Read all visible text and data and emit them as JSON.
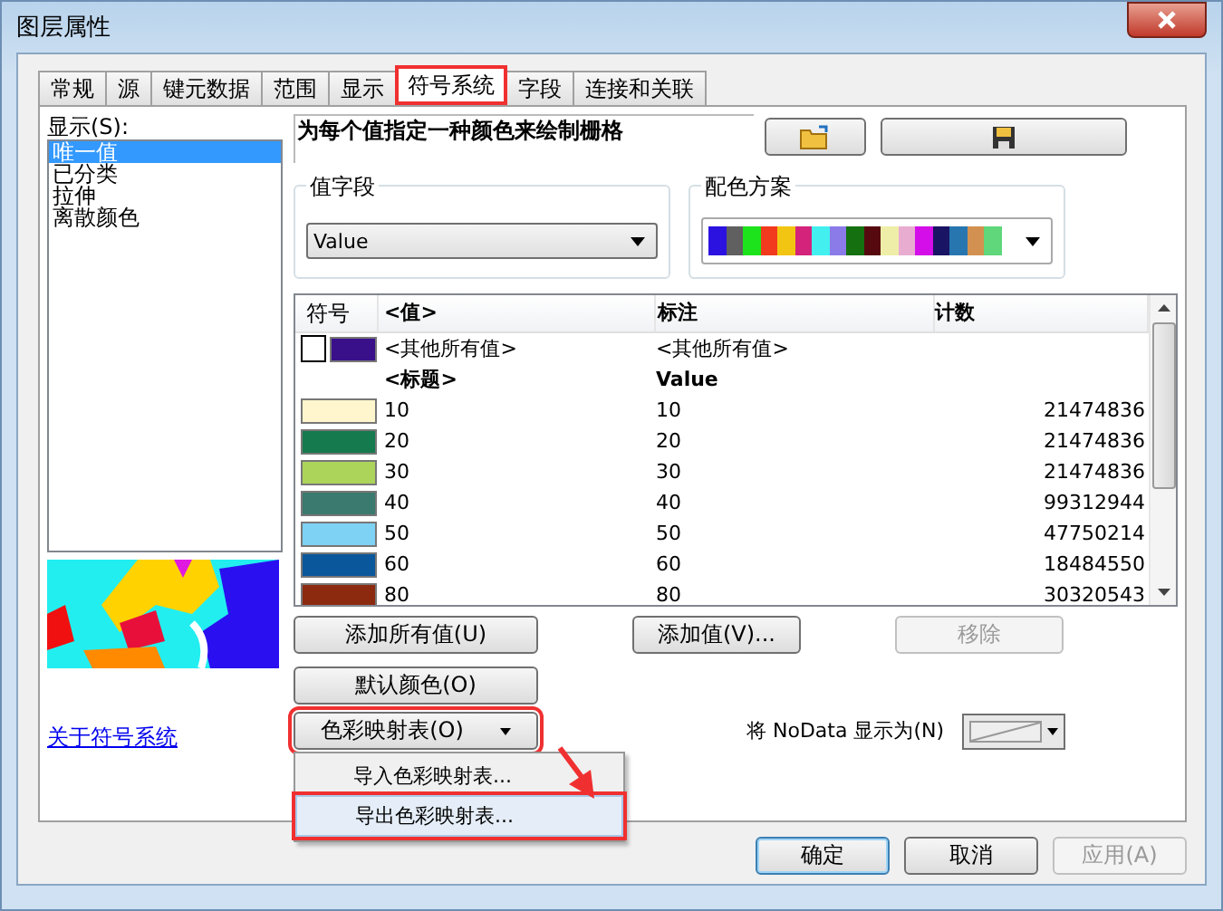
{
  "window": {
    "title": "图层属性"
  },
  "tabs": [
    {
      "label": "常规",
      "selected": false
    },
    {
      "label": "源",
      "selected": false
    },
    {
      "label": "键元数据",
      "selected": false
    },
    {
      "label": "范围",
      "selected": false
    },
    {
      "label": "显示",
      "selected": false
    },
    {
      "label": "符号系统",
      "selected": true
    },
    {
      "label": "字段",
      "selected": false
    },
    {
      "label": "连接和关联",
      "selected": false
    }
  ],
  "display": {
    "label": "显示(S):",
    "items": [
      {
        "label": "唯一值",
        "selected": true
      },
      {
        "label": "已分类",
        "selected": false
      },
      {
        "label": "拉伸",
        "selected": false
      },
      {
        "label": "离散颜色",
        "selected": false
      }
    ]
  },
  "about_link": "关于符号系统",
  "description": "为每个值指定一种颜色来绘制栅格",
  "value_field": {
    "label": "值字段",
    "value": "Value"
  },
  "color_scheme": {
    "label": "配色方案",
    "colors": [
      {
        "color": "#2b12e0"
      },
      {
        "color": "#606060"
      },
      {
        "color": "#1de31d"
      },
      {
        "color": "#f23a1e"
      },
      {
        "color": "#f2c512"
      },
      {
        "color": "#d3237b"
      },
      {
        "color": "#43f0ef"
      },
      {
        "color": "#8a7be8"
      },
      {
        "color": "#157010"
      },
      {
        "color": "#560a10"
      },
      {
        "color": "#eeeea8"
      },
      {
        "color": "#e8acd0"
      },
      {
        "color": "#d30ee8"
      },
      {
        "color": "#1a1464"
      },
      {
        "color": "#2876b0"
      },
      {
        "color": "#d29150"
      },
      {
        "color": "#5fd77a"
      }
    ]
  },
  "table": {
    "columns": [
      "符号",
      "<值>",
      "标注",
      "计数"
    ],
    "other_row": {
      "checked": false,
      "color": "#3a0f8a",
      "value": "<其他所有值>",
      "label": "<其他所有值>"
    },
    "heading_row": {
      "value": "<标题>",
      "label": "Value"
    },
    "rows": [
      {
        "color": "#fff6cd",
        "value": "10",
        "label": "10",
        "count": "21474836"
      },
      {
        "color": "#157a4d",
        "value": "20",
        "label": "20",
        "count": "21474836"
      },
      {
        "color": "#acd45a",
        "value": "30",
        "label": "30",
        "count": "21474836"
      },
      {
        "color": "#3b7a6e",
        "value": "40",
        "label": "40",
        "count": "99312944"
      },
      {
        "color": "#7ed2f4",
        "value": "50",
        "label": "50",
        "count": "47750214"
      },
      {
        "color": "#0b579c",
        "value": "60",
        "label": "60",
        "count": "18484550"
      },
      {
        "color": "#8c2a10",
        "value": "80",
        "label": "80",
        "count": "30320543"
      }
    ]
  },
  "buttons": {
    "add_all": "添加所有值(U)",
    "add_values": "添加值(V)...",
    "remove": {
      "label": "移除",
      "disabled": true
    },
    "default_colors": "默认颜色(O)",
    "colormap": "色彩映射表(O)"
  },
  "colormap_menu": [
    {
      "label": "导入色彩映射表...",
      "highlighted": false
    },
    {
      "label": "导出色彩映射表...",
      "highlighted": true
    }
  ],
  "nodata_label": "将 NoData 显示为(N)",
  "dialog_buttons": [
    {
      "label": "确定",
      "disabled": false,
      "default": true
    },
    {
      "label": "取消",
      "disabled": false,
      "default": false
    },
    {
      "label": "应用(A)",
      "disabled": true,
      "default": false
    }
  ]
}
